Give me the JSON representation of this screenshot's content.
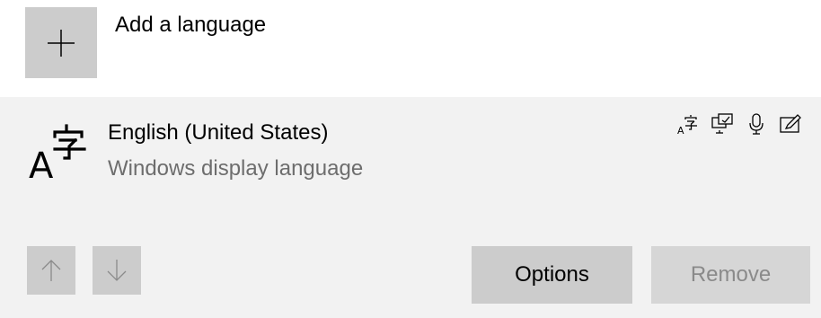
{
  "add_language": {
    "label": "Add a language",
    "icon": "plus-icon"
  },
  "language": {
    "name": "English (United States)",
    "subtitle": "Windows display language",
    "icon": "language-glyph-icon",
    "features": [
      {
        "icon": "language-pack-icon"
      },
      {
        "icon": "display-language-icon"
      },
      {
        "icon": "speech-icon"
      },
      {
        "icon": "handwriting-icon"
      }
    ]
  },
  "buttons": {
    "move_up_icon": "up-arrow-icon",
    "move_down_icon": "down-arrow-icon",
    "options_label": "Options",
    "remove_label": "Remove"
  },
  "colors": {
    "card_background": "#f2f2f2",
    "button_background": "#cccccc",
    "disabled_text": "#8a8a8a",
    "subtitle_text": "#6d6d6d"
  }
}
